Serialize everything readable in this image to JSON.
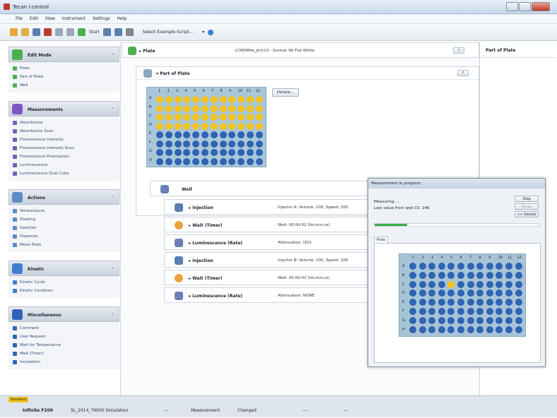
{
  "window": {
    "title": "Tecan i-control"
  },
  "menu": [
    "File",
    "Edit",
    "View",
    "Instrument",
    "Settings",
    "Help"
  ],
  "toolbar": {
    "start_label": "Start",
    "method_select": "Select Example Script..."
  },
  "left_panel": {
    "sections": [
      {
        "title": "Edit Mode",
        "icon": "plate-arrow-icon",
        "color": "#4caf50",
        "items": [
          {
            "label": "Plate",
            "icon": "plate-icon"
          },
          {
            "label": "Part of Plate",
            "icon": "part-plate-icon"
          },
          {
            "label": "Well",
            "icon": "well-icon"
          }
        ]
      },
      {
        "title": "Measurements",
        "icon": "measurement-icon",
        "color": "#7e57c2",
        "items": [
          {
            "label": "Absorbance",
            "icon": "absorbance-icon"
          },
          {
            "label": "Absorbance Scan",
            "icon": "absorbance-scan-icon"
          },
          {
            "label": "Fluorescence Intensity",
            "icon": "fluorescence-icon"
          },
          {
            "label": "Fluorescence Intensity Scan",
            "icon": "fluorescence-scan-icon"
          },
          {
            "label": "Fluorescence Polarization",
            "icon": "polarization-icon"
          },
          {
            "label": "Luminescence",
            "icon": "luminescence-icon"
          },
          {
            "label": "Luminescence Dual Color",
            "icon": "luminescence-dual-icon"
          }
        ]
      },
      {
        "title": "Actions",
        "icon": "actions-icon",
        "color": "#5b8cc7",
        "items": [
          {
            "label": "Temperature",
            "icon": "temperature-icon"
          },
          {
            "label": "Shaking",
            "icon": "shaking-icon"
          },
          {
            "label": "Injection",
            "icon": "injection-icon"
          },
          {
            "label": "Dispense",
            "icon": "dispense-icon"
          },
          {
            "label": "Move Plate",
            "icon": "move-plate-icon"
          }
        ]
      },
      {
        "title": "Kinetic",
        "icon": "kinetic-icon",
        "color": "#3f7fd0",
        "items": [
          {
            "label": "Kinetic Cycle",
            "icon": "kinetic-cycle-icon"
          },
          {
            "label": "Kinetic Condition",
            "icon": "kinetic-condition-icon"
          }
        ]
      },
      {
        "title": "Miscellaneous",
        "icon": "misc-icon",
        "color": "#2f64b8",
        "items": [
          {
            "label": "Comment",
            "icon": "comment-icon"
          },
          {
            "label": "User Request",
            "icon": "user-request-icon"
          },
          {
            "label": "Wait for Temperature",
            "icon": "wait-temp-icon"
          },
          {
            "label": "Wait (Timer)",
            "icon": "timer-icon"
          },
          {
            "label": "Incubation",
            "icon": "incubation-icon"
          }
        ]
      }
    ]
  },
  "plate": {
    "label": "Plate",
    "description": "[CRE96fw_jhm]-0 - Greiner 96 Flat White",
    "btn": "?"
  },
  "part_of_plate": {
    "label": "Part of Plate",
    "btn": "?",
    "details_label": "Details...",
    "cols": [
      "1",
      "2",
      "3",
      "4",
      "5",
      "6",
      "7",
      "8",
      "9",
      "10",
      "11",
      "12"
    ],
    "rows": [
      "A",
      "B",
      "C",
      "D",
      "E",
      "F",
      "G",
      "H"
    ],
    "selected_rows": 4
  },
  "well": {
    "label": "Well"
  },
  "steps": [
    {
      "label": "Injection",
      "desc": "Injector A: Volume: 100, Speed: 200",
      "icon": "injection-icon"
    },
    {
      "label": "Wait (Timer)",
      "desc": "Wait: 00:00:02 (hh:mm:ss)",
      "icon": "timer-icon"
    },
    {
      "label": "Luminescence (Rate)",
      "desc": "Attenuation: OD1",
      "icon": "luminescence-icon"
    },
    {
      "label": "Injection",
      "desc": "Injector B: Volume: 100, Speed: 200",
      "icon": "injection-icon"
    },
    {
      "label": "Wait (Timer)",
      "desc": "Wait: 00:00:02 (hh:mm:ss)",
      "icon": "timer-icon"
    },
    {
      "label": "Luminescence (Rate)",
      "desc": "Attenuation: NONE",
      "icon": "luminescence-icon"
    }
  ],
  "right_panel": {
    "title": "Part of Plate"
  },
  "dialog": {
    "title": "Measurement in progress",
    "status1": "Measuring ...",
    "status2": "Last value from well C5: 146",
    "buttons": [
      "Stop",
      "Pause",
      "<< Details"
    ],
    "progress": 0.2,
    "tab": "Plate",
    "cols": [
      "1",
      "2",
      "3",
      "4",
      "5",
      "6",
      "7",
      "8",
      "9",
      "10",
      "11",
      "12"
    ],
    "rows": [
      "A",
      "B",
      "C",
      "D",
      "E",
      "F",
      "G",
      "H"
    ],
    "highlight": {
      "row": 2,
      "col": 4
    }
  },
  "statusbar": {
    "tag": "Standard",
    "items": [
      "Infinite F200",
      "SL_2014_76000 Simulation",
      "---",
      "Measurement",
      "Changed",
      "---",
      "---"
    ]
  }
}
